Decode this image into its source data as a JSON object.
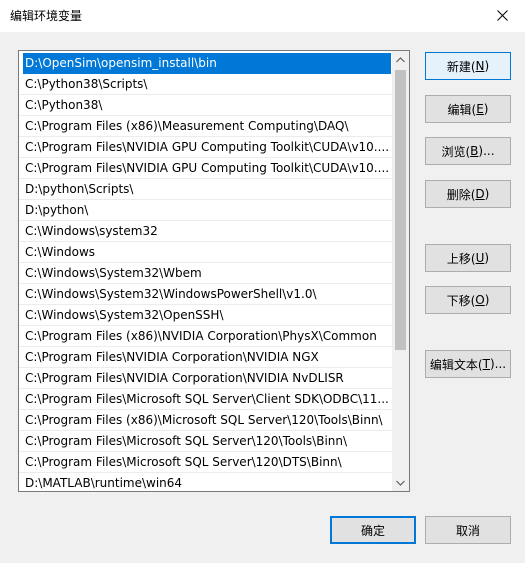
{
  "window": {
    "title": "编辑环境变量",
    "close_icon": "close-icon"
  },
  "path_list": {
    "items": [
      "D:\\OpenSim\\opensim_install\\bin",
      "C:\\Python38\\Scripts\\",
      "C:\\Python38\\",
      "C:\\Program Files (x86)\\Measurement Computing\\DAQ\\",
      "C:\\Program Files\\NVIDIA GPU Computing Toolkit\\CUDA\\v10....",
      "C:\\Program Files\\NVIDIA GPU Computing Toolkit\\CUDA\\v10....",
      "D:\\python\\Scripts\\",
      "D:\\python\\",
      "C:\\Windows\\system32",
      "C:\\Windows",
      "C:\\Windows\\System32\\Wbem",
      "C:\\Windows\\System32\\WindowsPowerShell\\v1.0\\",
      "C:\\Windows\\System32\\OpenSSH\\",
      "C:\\Program Files (x86)\\NVIDIA Corporation\\PhysX\\Common",
      "C:\\Program Files\\NVIDIA Corporation\\NVIDIA NGX",
      "C:\\Program Files\\NVIDIA Corporation\\NVIDIA NvDLISR",
      "C:\\Program Files\\Microsoft SQL Server\\Client SDK\\ODBC\\11...",
      "C:\\Program Files (x86)\\Microsoft SQL Server\\120\\Tools\\Binn\\",
      "C:\\Program Files\\Microsoft SQL Server\\120\\Tools\\Binn\\",
      "C:\\Program Files\\Microsoft SQL Server\\120\\DTS\\Binn\\",
      "D:\\MATLAB\\runtime\\win64"
    ],
    "selected_index": 0
  },
  "buttons": {
    "new": {
      "text": "新建(",
      "key": "N",
      "end": ")"
    },
    "edit": {
      "text": "编辑(",
      "key": "E",
      "end": ")"
    },
    "browse": {
      "text": "浏览(",
      "key": "B",
      "end": ")..."
    },
    "delete": {
      "text": "删除(",
      "key": "D",
      "end": ")"
    },
    "move_up": {
      "text": "上移(",
      "key": "U",
      "end": ")"
    },
    "move_down": {
      "text": "下移(",
      "key": "O",
      "end": ")"
    },
    "edit_text": {
      "text": "编辑文本(",
      "key": "T",
      "end": ")..."
    },
    "ok": "确定",
    "cancel": "取消"
  },
  "colors": {
    "selection": "#0078d7",
    "dialog_bg": "#f0f0f0"
  }
}
